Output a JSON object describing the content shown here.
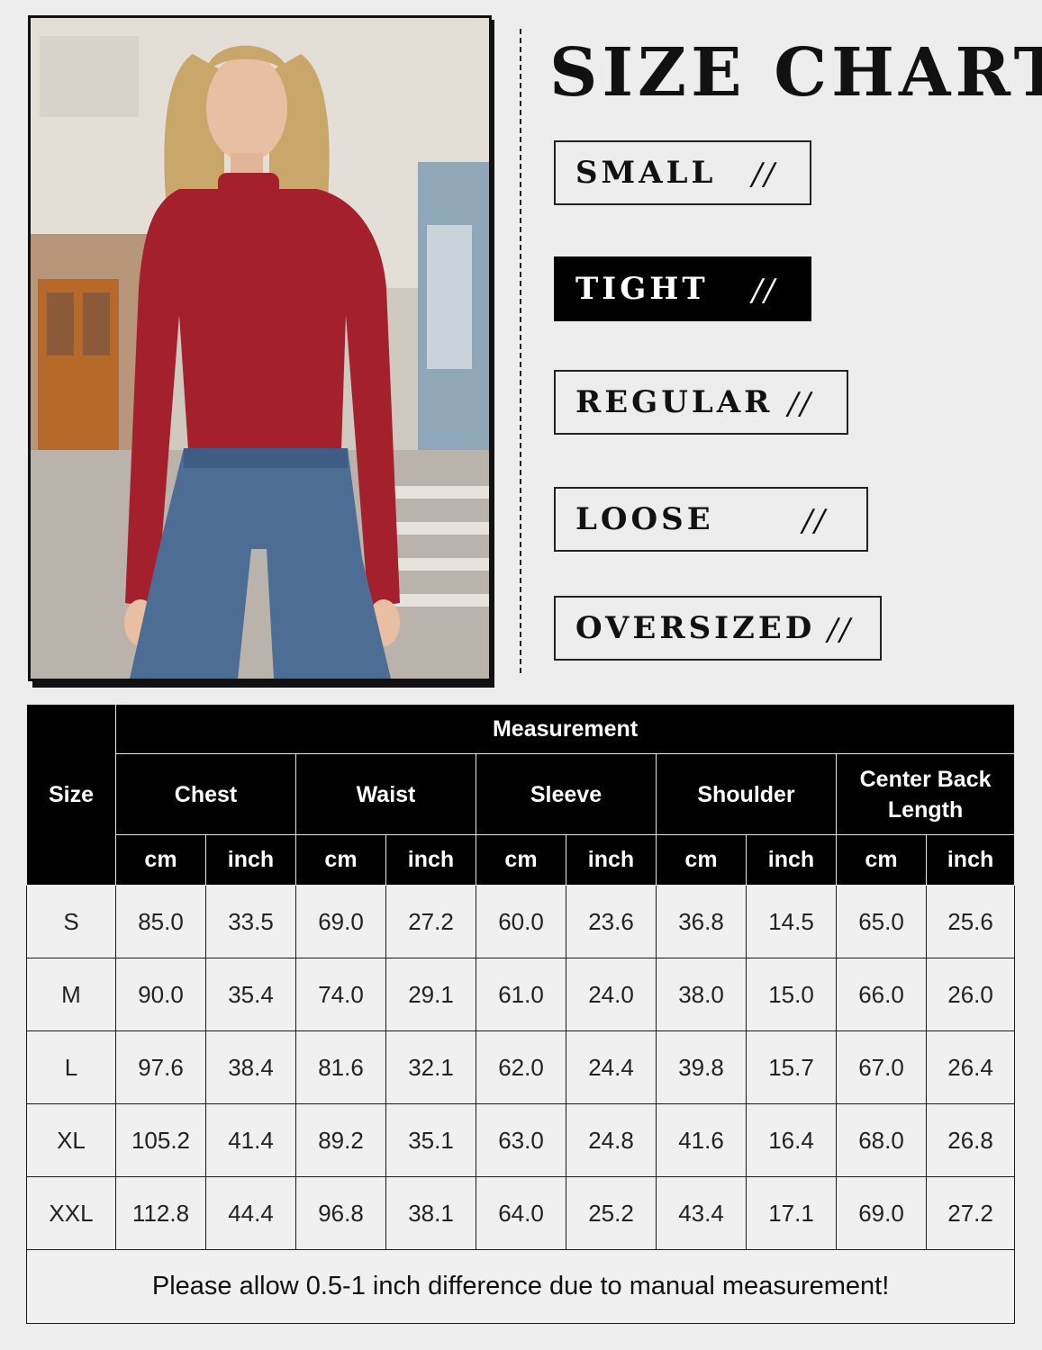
{
  "title": "SIZE CHART",
  "fit_scale": [
    {
      "label": "SMALL",
      "marker": "//",
      "selected": false
    },
    {
      "label": "TIGHT",
      "marker": "//",
      "selected": true
    },
    {
      "label": "REGULAR",
      "marker": "//",
      "selected": false
    },
    {
      "label": "LOOSE",
      "marker": "//",
      "selected": false
    },
    {
      "label": "OVERSIZED",
      "marker": "//",
      "selected": false
    }
  ],
  "photo": {
    "alt_icon": "model-photo",
    "garment_color": "#a3202c",
    "jeans_color": "#4e6d95"
  },
  "table": {
    "size_header": "Size",
    "group_header": "Measurement",
    "measures": [
      "Chest",
      "Waist",
      "Sleeve",
      "Shoulder",
      "Center Back Length"
    ],
    "units": [
      "cm",
      "inch"
    ],
    "rows": [
      {
        "size": "S",
        "values": [
          "85.0",
          "33.5",
          "69.0",
          "27.2",
          "60.0",
          "23.6",
          "36.8",
          "14.5",
          "65.0",
          "25.6"
        ]
      },
      {
        "size": "M",
        "values": [
          "90.0",
          "35.4",
          "74.0",
          "29.1",
          "61.0",
          "24.0",
          "38.0",
          "15.0",
          "66.0",
          "26.0"
        ]
      },
      {
        "size": "L",
        "values": [
          "97.6",
          "38.4",
          "81.6",
          "32.1",
          "62.0",
          "24.4",
          "39.8",
          "15.7",
          "67.0",
          "26.4"
        ]
      },
      {
        "size": "XL",
        "values": [
          "105.2",
          "41.4",
          "89.2",
          "35.1",
          "63.0",
          "24.8",
          "41.6",
          "16.4",
          "68.0",
          "26.8"
        ]
      },
      {
        "size": "XXL",
        "values": [
          "112.8",
          "44.4",
          "96.8",
          "38.1",
          "64.0",
          "25.2",
          "43.4",
          "17.1",
          "69.0",
          "27.2"
        ]
      }
    ],
    "note": "Please allow 0.5-1 inch difference due to manual measurement!"
  }
}
